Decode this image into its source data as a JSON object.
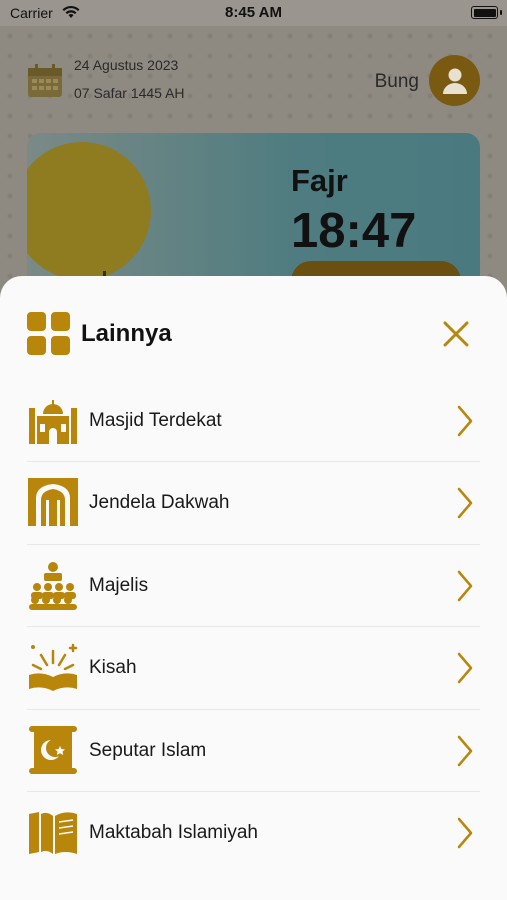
{
  "status_bar": {
    "carrier": "Carrier",
    "time": "8:45 AM"
  },
  "header": {
    "date_gregorian": "24 Agustus 2023",
    "date_hijri": "07 Safar 1445 AH",
    "user_name": "Bung"
  },
  "prayer_card": {
    "name": "Fajr",
    "time": "18:47"
  },
  "sheet": {
    "title": "Lainnya",
    "items": [
      {
        "label": "Masjid Terdekat",
        "icon": "mosque-icon"
      },
      {
        "label": "Jendela Dakwah",
        "icon": "window-arch-icon"
      },
      {
        "label": "Majelis",
        "icon": "assembly-icon"
      },
      {
        "label": "Kisah",
        "icon": "open-book-sparkle-icon"
      },
      {
        "label": "Seputar Islam",
        "icon": "scroll-crescent-icon"
      },
      {
        "label": "Maktabah Islamiyah",
        "icon": "library-book-icon"
      }
    ]
  },
  "colors": {
    "accent": "#b8860b",
    "sheet_bg": "#fafafa",
    "overlay": "#8e8a82"
  }
}
